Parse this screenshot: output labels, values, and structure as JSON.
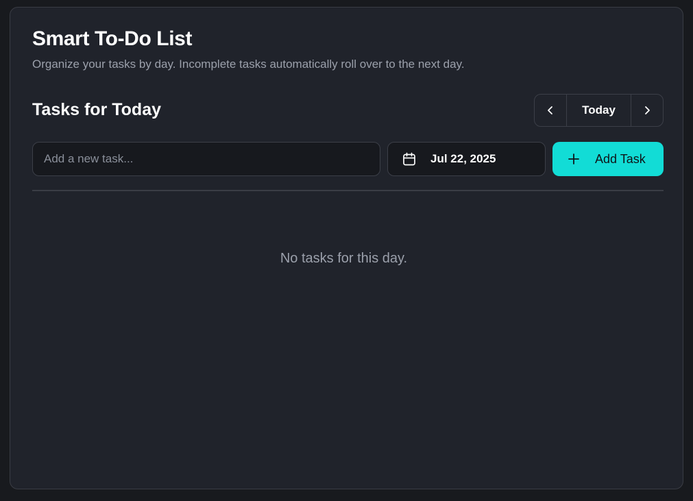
{
  "header": {
    "title": "Smart To-Do List",
    "subtitle": "Organize your tasks by day. Incomplete tasks automatically roll over to the next day."
  },
  "tasks_section": {
    "title": "Tasks for Today",
    "nav": {
      "prev_icon": "chevron-left-icon",
      "today_label": "Today",
      "next_icon": "chevron-right-icon"
    }
  },
  "add_form": {
    "task_input": {
      "value": "",
      "placeholder": "Add a new task..."
    },
    "date_picker": {
      "icon": "calendar-icon",
      "value": "Jul 22, 2025"
    },
    "add_button": {
      "icon": "plus-icon",
      "label": "Add Task"
    }
  },
  "task_list": {
    "items": [],
    "empty_message": "No tasks for this day."
  },
  "colors": {
    "page_background": "#181a1e",
    "card_background": "#20232b",
    "accent": "#12dcd6",
    "text_primary": "#ffffff",
    "text_muted": "#9ba0ab",
    "border": "#3c3f48"
  }
}
